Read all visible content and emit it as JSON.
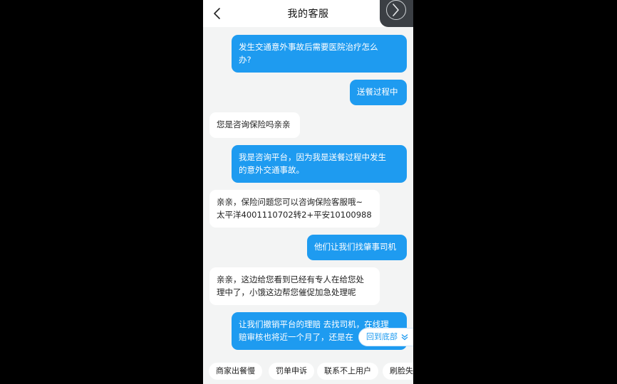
{
  "header": {
    "title": "我的客服"
  },
  "messages": [
    {
      "side": "out",
      "text": "发生交通意外事故后需要医院治疗怎么\n办?"
    },
    {
      "side": "out",
      "text": "送餐过程中"
    },
    {
      "side": "in",
      "text": "您是咨询保险吗亲亲"
    },
    {
      "side": "out",
      "text": "我是咨询平台，因为我是送餐过程中发生\n的意外交通事故。"
    },
    {
      "side": "in",
      "text": "亲亲，保险问题您可以咨询保险客服哦~\n太平洋4001110702转2+平安10100988"
    },
    {
      "side": "out",
      "text": "他们让我们找肇事司机"
    },
    {
      "side": "in",
      "text": "亲亲，这边给您看到已经有专人在给您处\n理中了，小饿这边帮您催促加急处理呢"
    },
    {
      "side": "out",
      "text": "让我们撤销平台的理赔 去找司机，在线理\n赔审核也将近一个月了，还是在"
    }
  ],
  "back_to_bottom": "回到底部",
  "quick_replies": [
    "商家出餐慢",
    "罚单申诉",
    "联系不上用户",
    "刷脸失"
  ],
  "colors": {
    "outgoing_bubble": "#1e9bf0",
    "incoming_bubble": "#ffffff",
    "chat_background": "#f3f4f4"
  },
  "icons": {
    "back": "chevron-left-icon",
    "next": "chevron-right-icon",
    "scroll_down": "double-chevron-down-icon"
  }
}
